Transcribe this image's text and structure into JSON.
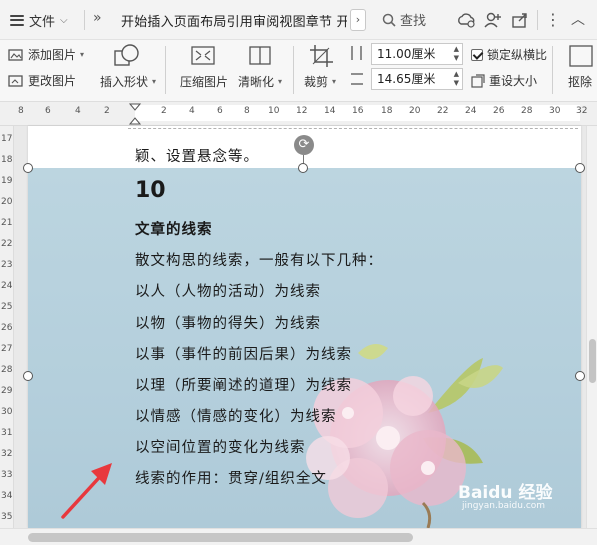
{
  "topbar": {
    "menu_label": "文件",
    "tabs_text": "开始插入页面布局引用审阅视图章节 开发工",
    "search_label": "查找"
  },
  "ribbon": {
    "add_picture": "添加图片",
    "change_picture": "更改图片",
    "insert_shape": "插入形状",
    "compress_picture": "压缩图片",
    "sharpen": "清晰化",
    "crop": "裁剪",
    "height_value": "11.00厘米",
    "width_value": "14.65厘米",
    "lock_ratio": "锁定纵横比",
    "lock_ratio_checked": true,
    "reset_size": "重设大小",
    "cutout_partial": "抠除"
  },
  "ruler": {
    "h_ticks": [
      "8",
      "6",
      "4",
      "2",
      "2",
      "4",
      "6",
      "8",
      "10",
      "12",
      "14",
      "16",
      "18",
      "20",
      "22",
      "24",
      "26",
      "28",
      "30",
      "32"
    ],
    "v_ticks": [
      "17",
      "18",
      "19",
      "20",
      "21",
      "22",
      "23",
      "24",
      "25",
      "26",
      "27",
      "28",
      "29",
      "30",
      "31",
      "32",
      "33",
      "34",
      "35"
    ]
  },
  "document": {
    "line_prev": "颖、设置悬念等。",
    "number": "10",
    "title": "文章的线索",
    "lines": [
      "散文构思的线索，一般有以下几种：",
      "以人（人物的活动）为线索",
      "以物（事物的得失）为线索",
      "以事（事件的前因后果）为线索",
      "以理（所要阐述的道理）为线索",
      "以情感（情感的变化）为线索",
      "以空间位置的变化为线索",
      "线索的作用：贯穿/组织全文"
    ]
  },
  "watermark": {
    "brand": "Baidu 经验",
    "url": "jingyan.baidu.com"
  },
  "colors": {
    "picture_bg": "#b9d3df",
    "arrow": "#e8383d"
  }
}
